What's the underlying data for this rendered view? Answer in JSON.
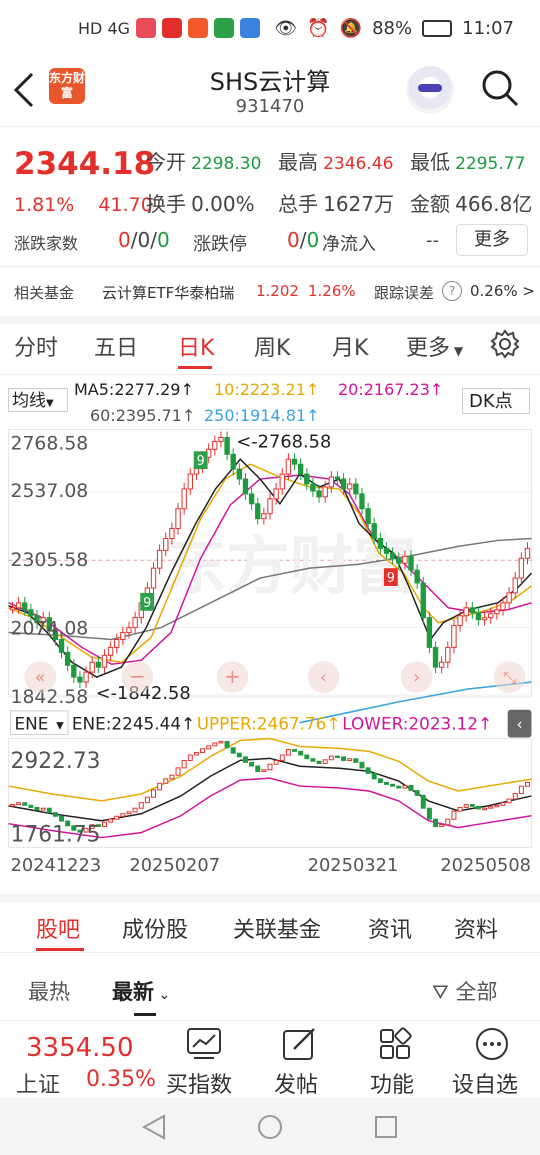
{
  "status_bar": {
    "left_icons": "HD 4G",
    "battery": "88%",
    "time": "11:07"
  },
  "header": {
    "back_label": "<",
    "logo_text": "东方财富",
    "title": "SHS云计算",
    "code": "931470"
  },
  "quote": {
    "price": "2344.18",
    "change_pct": "1.81%",
    "change_abs": "41.70",
    "open_label": "今开",
    "open": "2298.30",
    "high_label": "最高",
    "high": "2346.46",
    "low_label": "最低",
    "low": "2295.77",
    "turnover_label": "换手",
    "turnover": "0.00%",
    "volume_label": "总手",
    "volume": "1627万",
    "amount_label": "金额",
    "amount": "466.8亿",
    "updown_label": "涨跌家数",
    "up": "0",
    "flat": "0",
    "down": "0",
    "limit_label": "涨跌停",
    "limit_up": "0",
    "limit_down": "0",
    "netflow_label": "净流入",
    "netflow": "--",
    "more_button": "更多"
  },
  "fund_row": {
    "label": "相关基金",
    "fund_name": "云计算ETF华泰柏瑞",
    "fund_price": "1.202",
    "fund_pct": "1.26%",
    "tracking_label": "跟踪误差",
    "tracking_value": "0.26% >"
  },
  "period_tabs": [
    "分时",
    "五日",
    "日K",
    "周K",
    "月K",
    "更多"
  ],
  "active_period": "日K",
  "indicator_row": {
    "selector": "均线",
    "ma5": "MA5:2277.29↑",
    "ma10": "10:2223.21↑",
    "ma20": "20:2167.23↑",
    "ma60": "60:2395.71↑",
    "ma250": "250:1914.81↑",
    "dk_button": "DK点"
  },
  "main_chart": {
    "y_labels": [
      "2768.58",
      "2537.08",
      "2305.58",
      "2074.08",
      "1842.58"
    ],
    "max_annotation": "<-2768.58",
    "min_annotation": "<-1842.58",
    "watermark": "东方财富"
  },
  "ene_row": {
    "selector": "ENE",
    "ene": "ENE:2245.44↑",
    "upper": "UPPER:2467.76↑",
    "lower": "LOWER:2023.12↑"
  },
  "sub_chart": {
    "y_labels": [
      "2922.73",
      "1761.75"
    ],
    "x_labels": [
      "20241223",
      "20250207",
      "20250321",
      "20250508"
    ]
  },
  "colors": {
    "up": "#e3302c",
    "down": "#1e9b3e",
    "ma5": "#222222",
    "ma10": "#e8a800",
    "ma20": "#d0139b",
    "ma60": "#777777",
    "ma250": "#3aa3e0"
  },
  "bottom_tabs": [
    "股吧",
    "成份股",
    "关联基金",
    "资讯",
    "资料"
  ],
  "sort_options": {
    "hot": "最热",
    "latest": "最新",
    "filter": "全部"
  },
  "footer": {
    "index_value": "3354.50",
    "index_name": "上证",
    "index_pct": "0.35%",
    "buttons": [
      "买指数",
      "发帖",
      "功能",
      "设自选"
    ]
  }
}
